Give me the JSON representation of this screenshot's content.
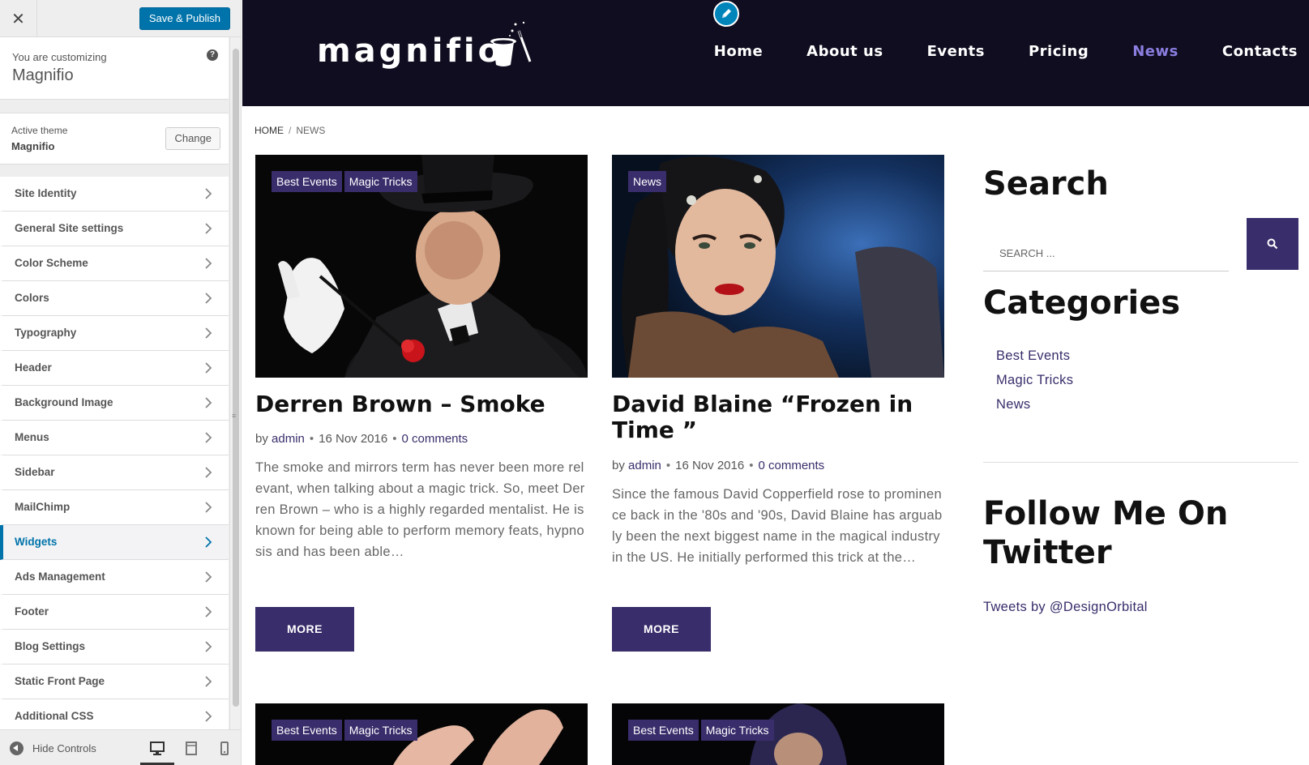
{
  "customizer": {
    "save_label": "Save & Publish",
    "close_glyph": "✕",
    "info_label": "You are customizing",
    "site_name": "Magnifio",
    "help_glyph": "?",
    "active_theme_label": "Active theme",
    "active_theme_name": "Magnifio",
    "change_label": "Change",
    "sections": [
      {
        "label": "Site Identity"
      },
      {
        "label": "General Site settings"
      },
      {
        "label": "Color Scheme"
      },
      {
        "label": "Colors"
      },
      {
        "label": "Typography"
      },
      {
        "label": "Header"
      },
      {
        "label": "Background Image"
      },
      {
        "label": "Menus"
      },
      {
        "label": "Sidebar"
      },
      {
        "label": "MailChimp"
      },
      {
        "label": "Widgets"
      },
      {
        "label": "Ads Management"
      },
      {
        "label": "Footer"
      },
      {
        "label": "Blog Settings"
      },
      {
        "label": "Static Front Page"
      },
      {
        "label": "Additional CSS"
      }
    ],
    "active_section": "Widgets",
    "hide_controls_label": "Hide Controls",
    "devices": [
      "desktop-icon",
      "tablet-icon",
      "mobile-icon"
    ],
    "scroll_grip": "≡"
  },
  "site": {
    "logo_text": "magnifio",
    "nav": [
      "Home",
      "About us",
      "Events",
      "Pricing",
      "News",
      "Contacts"
    ],
    "current_nav": "News",
    "breadcrumb": {
      "home": "Home",
      "sep": "/",
      "current": "News"
    },
    "posts": [
      {
        "tags": [
          "Best Events",
          "Magic Tricks"
        ],
        "title": "Derren Brown – Smoke",
        "meta_by": "by",
        "author": "admin",
        "date": "16 Nov 2016",
        "comments": "0 comments",
        "excerpt": "The smoke and mirrors term has never been more relevant, when talking about a magic trick. So, meet Derren Brown – who is a highly regarded mentalist. He is known for being able to perform memory feats, hypnosis and has been able…",
        "more": "MORE"
      },
      {
        "tags": [
          "News"
        ],
        "title": "David Blaine “Frozen in Time ”",
        "meta_by": "by",
        "author": "admin",
        "date": "16 Nov 2016",
        "comments": "0 comments",
        "excerpt": "Since the famous David Copperfield rose to prominence back in the '80s and '90s, David Blaine has arguably been the next biggest name in the magical industry in the US. He initially performed this trick at the…",
        "more": "MORE"
      },
      {
        "tags": [
          "Best Events",
          "Magic Tricks"
        ]
      },
      {
        "tags": [
          "Best Events",
          "Magic Tricks"
        ]
      }
    ],
    "sidebar": {
      "search_title": "Search",
      "search_placeholder": "SEARCH ...",
      "categories_title": "Categories",
      "categories": [
        "Best Events",
        "Magic Tricks",
        "News"
      ],
      "twitter_title": "Follow Me On Twitter",
      "tweets_by": "Tweets by @DesignOrbital"
    }
  },
  "colors": {
    "wp_blue": "#0073aa",
    "header_bg": "#0f0d1f",
    "accent_purple": "#3a2d6b",
    "nav_active": "#8a7ee0"
  }
}
